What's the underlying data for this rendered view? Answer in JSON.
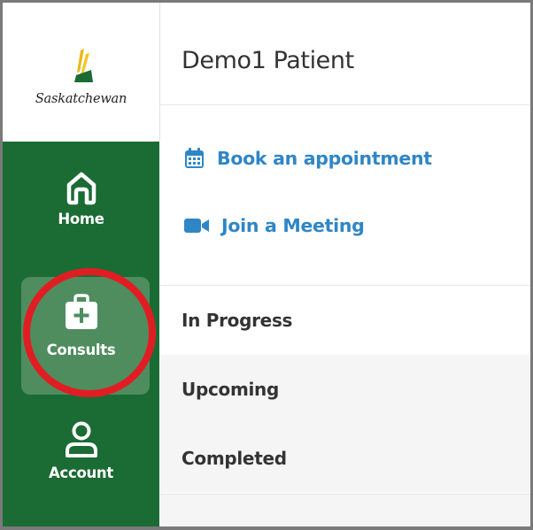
{
  "brand": {
    "logo_text": "Saskatchewan",
    "logo_icon": "wheat-sheaf-logo",
    "colors": {
      "sidebar": "#1b6b34",
      "active_item": "#4f8d5f",
      "link": "#2f86c6",
      "highlight": "#e11d24"
    }
  },
  "sidebar": {
    "items": [
      {
        "label": "Home",
        "icon": "home-icon",
        "active": false
      },
      {
        "label": "Consults",
        "icon": "medical-case-icon",
        "active": true
      },
      {
        "label": "Account",
        "icon": "user-icon",
        "active": false
      }
    ]
  },
  "header": {
    "patient_name": "Demo1 Patient"
  },
  "actions": {
    "book": {
      "label": "Book an appointment",
      "icon": "calendar-icon"
    },
    "join": {
      "label": "Join a Meeting",
      "icon": "video-camera-icon"
    }
  },
  "consult_tabs": [
    {
      "label": "In Progress",
      "selected": true
    },
    {
      "label": "Upcoming",
      "selected": false
    },
    {
      "label": "Completed",
      "selected": false
    }
  ]
}
